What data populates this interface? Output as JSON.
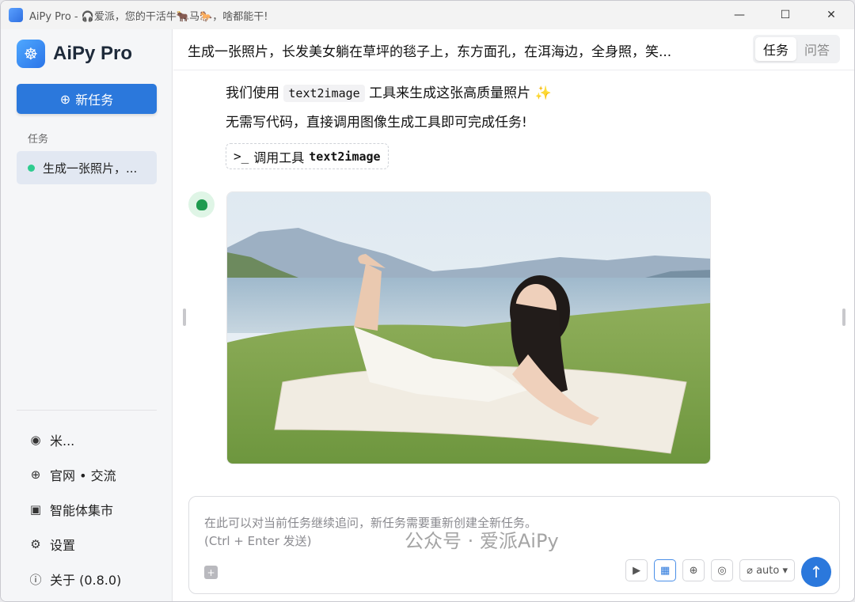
{
  "window": {
    "title": "AiPy Pro - 🎧爱派，您的干活牛🐂马🐎，啥都能干!",
    "controls": {
      "minimize": "—",
      "maximize": "☐",
      "close": "✕"
    }
  },
  "sidebar": {
    "brand": "AiPy Pro",
    "new_task_label": "新任务",
    "section_label": "任务",
    "tasks": [
      {
        "label": "生成一张照片，...",
        "status_color": "#2ecc8f"
      }
    ],
    "menu": [
      {
        "icon": "user-icon",
        "glyph": "◉",
        "label": "米..."
      },
      {
        "icon": "globe-icon",
        "glyph": "⊕",
        "label": "官网 • 交流"
      },
      {
        "icon": "store-icon",
        "glyph": "▣",
        "label": "智能体集市"
      },
      {
        "icon": "gear-icon",
        "glyph": "⚙",
        "label": "设置"
      },
      {
        "icon": "info-icon",
        "glyph": "ⓘ",
        "label": "关于 (0.8.0)"
      }
    ]
  },
  "header": {
    "task_title": "生成一张照片，长发美女躺在草坪的毯子上，东方面孔，在洱海边，全身照，笑...",
    "tabs": [
      {
        "label": "任务",
        "active": true
      },
      {
        "label": "问答",
        "active": false
      }
    ]
  },
  "messages": {
    "line1_prefix": "我们使用",
    "line1_code": "text2image",
    "line1_suffix": "工具来生成这张高质量照片",
    "line1_emoji": "✨",
    "line2": "无需写代码，直接调用图像生成工具即可完成任务!",
    "tool_prompt": ">_",
    "tool_label": "调用工具",
    "tool_name": "text2image"
  },
  "composer": {
    "placeholder_line1": "在此可以对当前任务继续追问，新任务需要重新创建全新任务。",
    "placeholder_line2": "(Ctrl + Enter 发送)",
    "model": "auto",
    "send_glyph": "↑"
  },
  "watermark": "公众号 · 爱派AiPy",
  "colors": {
    "accent": "#2b78dc",
    "status_green": "#2ecc8f"
  }
}
